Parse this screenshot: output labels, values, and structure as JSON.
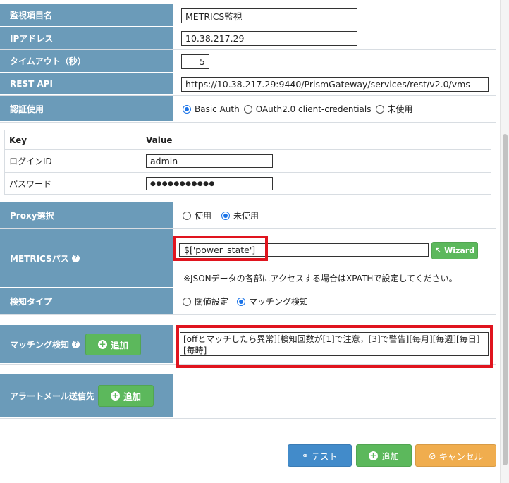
{
  "form": {
    "monitor_name": {
      "label": "監視項目名",
      "value": "METRICS監視"
    },
    "ip_address": {
      "label": "IPアドレス",
      "value": "10.38.217.29"
    },
    "timeout": {
      "label": "タイムアウト（秒）",
      "value": "5"
    },
    "rest_api": {
      "label": "REST API",
      "value": "https://10.38.217.29:9440/PrismGateway/services/rest/v2.0/vms"
    },
    "auth": {
      "label": "認証使用",
      "options": [
        "Basic Auth",
        "OAuth2.0 client-credentials",
        "未使用"
      ],
      "selected": "Basic Auth"
    },
    "credentials": {
      "header_key": "Key",
      "header_value": "Value",
      "login_id_label": "ログインID",
      "login_id_value": "admin",
      "password_label": "パスワード",
      "password_value": "●●●●●●●●●●●"
    },
    "proxy": {
      "label": "Proxy選択",
      "options": [
        "使用",
        "未使用"
      ],
      "selected": "未使用"
    },
    "metrics_path": {
      "label": "METRICSパス",
      "value": "$['power_state']",
      "wizard_label": "Wizard",
      "note": "※JSONデータの各部にアクセスする場合はXPATHで設定してください。"
    },
    "detect_type": {
      "label": "検知タイプ",
      "options": [
        "閾値設定",
        "マッチング検知"
      ],
      "selected": "マッチング検知"
    },
    "matching": {
      "label": "マッチング検知",
      "add_label": "追加",
      "rule_text": "[offとマッチしたら異常][検知回数が[1]で注意，[3]で警告][毎月][毎週][毎日][毎時]"
    },
    "alert_mail": {
      "label": "アラートメール送信先",
      "add_label": "追加"
    }
  },
  "footer": {
    "test_label": "テスト",
    "add_label": "追加",
    "cancel_label": "キャンセル"
  },
  "colors": {
    "label_bg": "#6b9bb9",
    "highlight": "#e0141e",
    "green": "#5cb85c",
    "blue": "#428bca",
    "orange": "#f0ad4e"
  }
}
